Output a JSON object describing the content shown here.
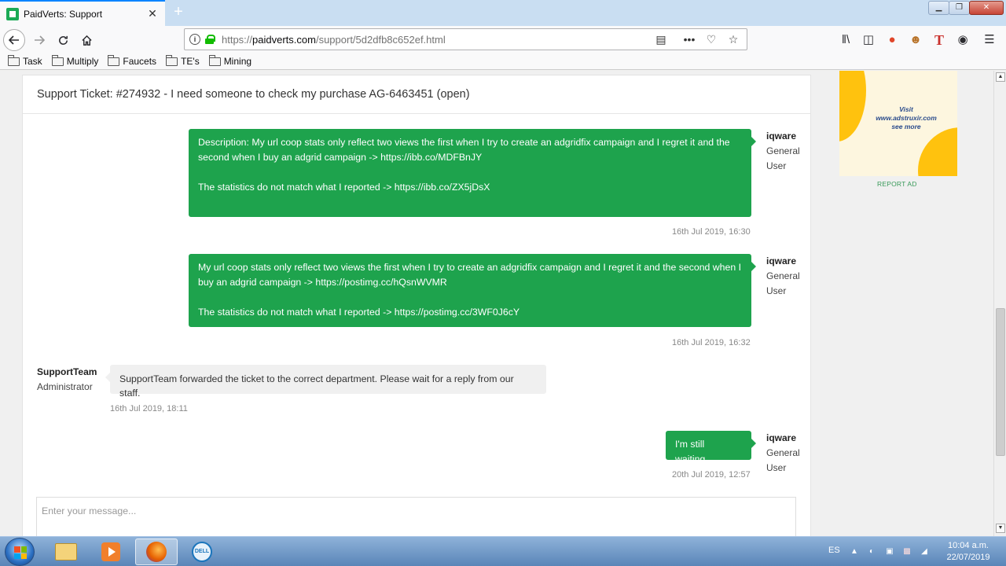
{
  "browser": {
    "tab_title": "PaidVerts: Support",
    "tab_close": "✕",
    "new_tab": "+",
    "url_scheme": "https://",
    "url_domain": "paidverts.com",
    "url_path": "/support/5d2dfb8c652ef.html",
    "bookmarks": [
      "Task",
      "Multiply",
      "Faucets",
      "TE's",
      "Mining"
    ]
  },
  "ticket": {
    "header": "Support Ticket: #274932 - I need someone to check my purchase AG-6463451 (open)",
    "messages": [
      {
        "author": "iqware",
        "role_line1": "General",
        "role_line2": "User",
        "paragraph1": "Description: My url coop stats only reflect two views the first when I try to create an adgridfix campaign and I regret it and the second when I buy an adgrid campaign -> https://ibb.co/MDFBnJY",
        "paragraph2": "The statistics do not match what I reported -> https://ibb.co/ZX5jDsX",
        "timestamp": "16th Jul 2019, 16:30"
      },
      {
        "author": "iqware",
        "role_line1": "General",
        "role_line2": "User",
        "paragraph1": "My url coop stats only reflect two views the first when I try to create an adgridfix campaign and I regret it and the second when I buy an adgrid campaign -> https://postimg.cc/hQsnWVMR",
        "paragraph2": "The statistics do not match what I reported -> https://postimg.cc/3WF0J6cY",
        "timestamp": "16th Jul 2019, 16:32"
      },
      {
        "author": "SupportTeam",
        "role": "Administrator",
        "text": "SupportTeam forwarded the ticket to the correct department. Please wait for a reply from our staff.",
        "timestamp": "16th Jul 2019, 18:11"
      },
      {
        "author": "iqware",
        "role_line1": "General",
        "role_line2": "User",
        "text": "I'm still waiting..",
        "timestamp": "20th Jul 2019, 12:57"
      }
    ],
    "input_placeholder": "Enter your message..."
  },
  "ad": {
    "line1": "Visit",
    "line2": "www.adstruxir.com",
    "line3": "see more",
    "report_label": "REPORT AD"
  },
  "taskbar": {
    "language": "ES",
    "time": "10:04 a.m.",
    "date": "22/07/2019"
  },
  "colors": {
    "user_bubble": "#1ea34d",
    "admin_bubble": "#f0f0f0",
    "ad_yellow": "#ffc20e"
  }
}
